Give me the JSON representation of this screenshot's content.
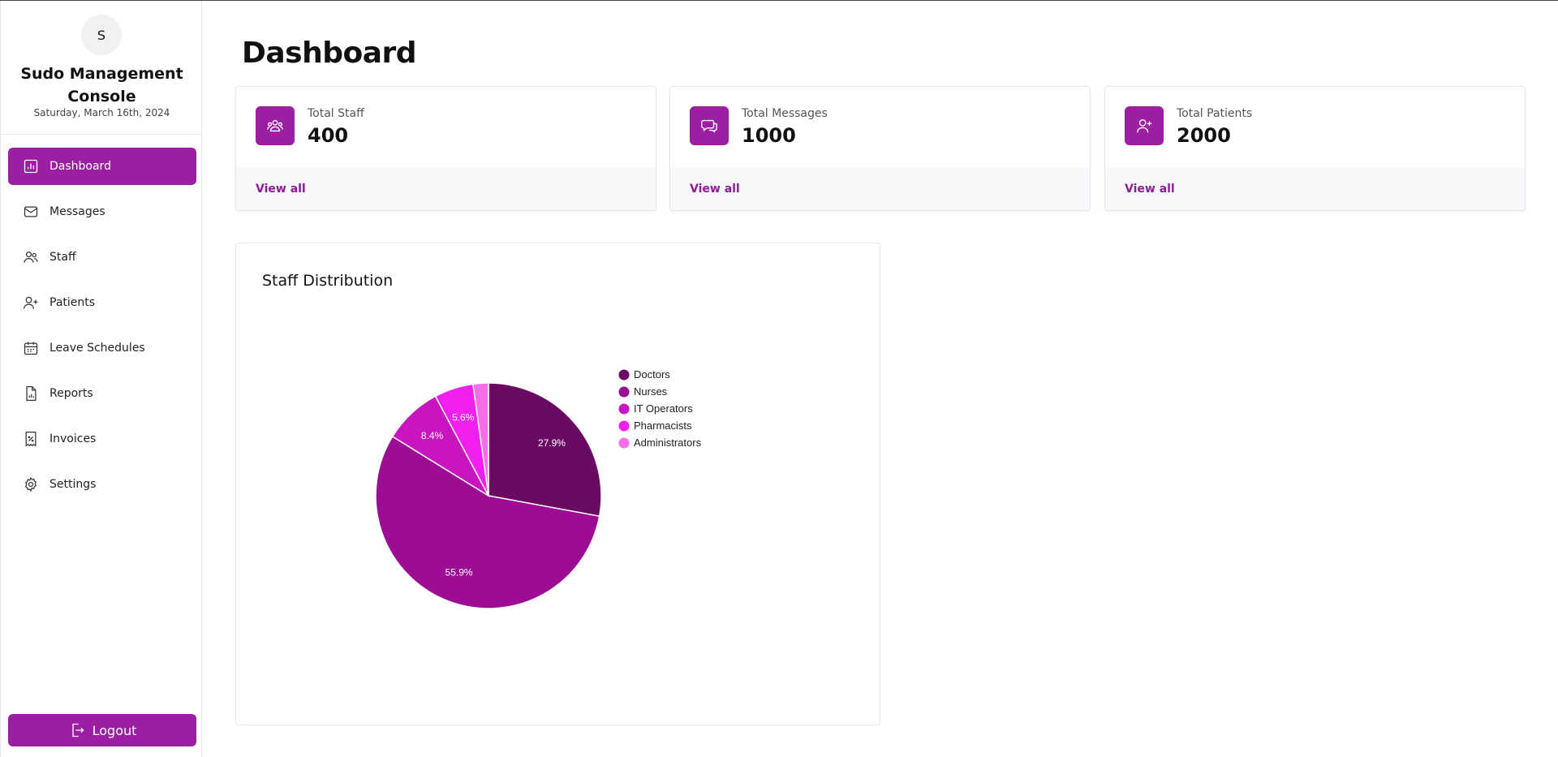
{
  "sidebar": {
    "avatar_initial": "S",
    "brand": "Sudo Management Console",
    "date": "Saturday, March 16th, 2024",
    "items": [
      {
        "label": "Dashboard",
        "icon": "chart-bar-icon",
        "active": true
      },
      {
        "label": "Messages",
        "icon": "envelope-icon",
        "active": false
      },
      {
        "label": "Staff",
        "icon": "users-icon",
        "active": false
      },
      {
        "label": "Patients",
        "icon": "user-plus-icon",
        "active": false
      },
      {
        "label": "Leave Schedules",
        "icon": "calendar-icon",
        "active": false
      },
      {
        "label": "Reports",
        "icon": "document-chart-icon",
        "active": false
      },
      {
        "label": "Invoices",
        "icon": "receipt-percent-icon",
        "active": false
      },
      {
        "label": "Settings",
        "icon": "gear-icon",
        "active": false
      }
    ],
    "logout_label": "Logout"
  },
  "main": {
    "title": "Dashboard",
    "cards": [
      {
        "label": "Total Staff",
        "value": "400",
        "link": "View all",
        "icon": "users-icon"
      },
      {
        "label": "Total Messages",
        "value": "1000",
        "link": "View all",
        "icon": "chat-bubbles-icon"
      },
      {
        "label": "Total Patients",
        "value": "2000",
        "link": "View all",
        "icon": "user-plus-icon"
      }
    ],
    "chart_title": "Staff Distribution"
  },
  "colors": {
    "accent": "#9b1ea3",
    "link": "#8e1a96"
  },
  "chart_data": {
    "type": "pie",
    "title": "Staff Distribution",
    "legend_position": "right",
    "categories": [
      "Doctors",
      "Nurses",
      "IT Operators",
      "Pharmacists",
      "Administrators"
    ],
    "values": [
      27.9,
      55.9,
      8.4,
      5.6,
      2.2
    ],
    "labels": [
      "27.9%",
      "55.9%",
      "8.4%",
      "5.6%",
      ""
    ],
    "colors": [
      "#6b0a62",
      "#9c0d94",
      "#c815c0",
      "#f21ff0",
      "#f56ee8"
    ]
  }
}
